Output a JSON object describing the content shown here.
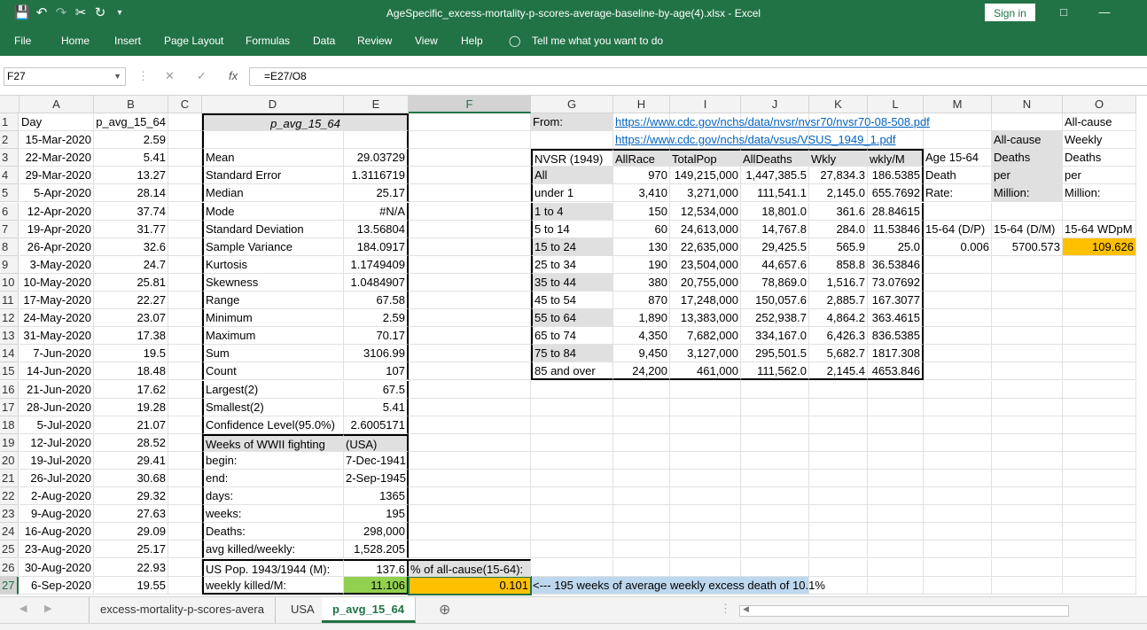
{
  "title": "AgeSpecific_excess-mortality-p-scores-average-baseline-by-age(4).xlsx  -  Excel",
  "sign_in": "Sign in",
  "ribbon_tabs": [
    "File",
    "Home",
    "Insert",
    "Page Layout",
    "Formulas",
    "Data",
    "Review",
    "View",
    "Help"
  ],
  "tell_me": "Tell me what you want to do",
  "name_box": "F27",
  "fx": "fx",
  "formula": "=E27/O8",
  "columns": [
    "A",
    "B",
    "C",
    "D",
    "E",
    "F",
    "G",
    "H",
    "I",
    "J",
    "K",
    "L",
    "M",
    "N",
    "O"
  ],
  "rows": [
    "1",
    "2",
    "3",
    "4",
    "5",
    "6",
    "7",
    "8",
    "9",
    "10",
    "11",
    "12",
    "13",
    "14",
    "15",
    "16",
    "17",
    "18",
    "19",
    "20",
    "21",
    "22",
    "23",
    "24",
    "25",
    "26",
    "27"
  ],
  "colA": [
    "Day",
    "15-Mar-2020",
    "22-Mar-2020",
    "29-Mar-2020",
    "5-Apr-2020",
    "12-Apr-2020",
    "19-Apr-2020",
    "26-Apr-2020",
    "3-May-2020",
    "10-May-2020",
    "17-May-2020",
    "24-May-2020",
    "31-May-2020",
    "7-Jun-2020",
    "14-Jun-2020",
    "21-Jun-2020",
    "28-Jun-2020",
    "5-Jul-2020",
    "12-Jul-2020",
    "19-Jul-2020",
    "26-Jul-2020",
    "2-Aug-2020",
    "9-Aug-2020",
    "16-Aug-2020",
    "23-Aug-2020",
    "30-Aug-2020",
    "6-Sep-2020"
  ],
  "colB": [
    "p_avg_15_64",
    "2.59",
    "5.41",
    "13.27",
    "28.14",
    "37.74",
    "31.77",
    "32.6",
    "24.7",
    "25.81",
    "22.27",
    "23.07",
    "17.38",
    "19.5",
    "18.48",
    "17.62",
    "19.28",
    "21.07",
    "28.52",
    "29.41",
    "30.68",
    "29.32",
    "27.63",
    "29.09",
    "25.17",
    "22.93",
    "19.55"
  ],
  "colD": [
    "p_avg_15_64",
    "",
    "Mean",
    "Standard Error",
    "Median",
    "Mode",
    "Standard Deviation",
    "Sample Variance",
    "Kurtosis",
    "Skewness",
    "Range",
    "Minimum",
    "Maximum",
    "Sum",
    "Count",
    "Largest(2)",
    "Smallest(2)",
    "Confidence Level(95.0%)",
    "Weeks of WWII fighting",
    "begin:",
    "end:",
    "days:",
    "weeks:",
    "Deaths:",
    "avg killed/weekly:",
    "US Pop. 1943/1944 (M):",
    "weekly killed/M:"
  ],
  "colE": [
    "",
    "",
    "29.03729",
    "1.3116719",
    "25.17",
    "#N/A",
    "13.56804",
    "184.0917",
    "1.1749409",
    "1.0484907",
    "67.58",
    "2.59",
    "70.17",
    "3106.99",
    "107",
    "67.5",
    "5.41",
    "2.6005171",
    "(USA)",
    "7-Dec-1941",
    "2-Sep-1945",
    "1365",
    "195",
    "298,000",
    "1,528.205",
    "137.6",
    "11.106"
  ],
  "F26": "% of all-cause(15-64):",
  "F27": "0.101",
  "G27": "<--- 195 weeks of average weekly excess death of 10.1%",
  "G1": "From:",
  "H1": "https://www.cdc.gov/nchs/data/nvsr/nvsr70/nvsr70-08-508.pdf",
  "H2": "https://www.cdc.gov/nchs/data/vsus/VSUS_1949_1.pdf",
  "nvsr_header": [
    "NVSR (1949)",
    "AllRace",
    "TotalPop",
    "AllDeaths",
    "Wkly",
    "wkly/M"
  ],
  "nvsr_rows": [
    [
      "All",
      "970",
      "149,215,000",
      "1,447,385.5",
      "27,834.3",
      "186.5385"
    ],
    [
      "under 1",
      "3,410",
      "3,271,000",
      "111,541.1",
      "2,145.0",
      "655.7692"
    ],
    [
      "1 to 4",
      "150",
      "12,534,000",
      "18,801.0",
      "361.6",
      "28.84615"
    ],
    [
      "5 to 14",
      "60",
      "24,613,000",
      "14,767.8",
      "284.0",
      "11.53846"
    ],
    [
      "15 to 24",
      "130",
      "22,635,000",
      "29,425.5",
      "565.9",
      "25.0"
    ],
    [
      "25 to 34",
      "190",
      "23,504,000",
      "44,657.6",
      "858.8",
      "36.53846"
    ],
    [
      "35 to 44",
      "380",
      "20,755,000",
      "78,869.0",
      "1,516.7",
      "73.07692"
    ],
    [
      "45 to 54",
      "870",
      "17,248,000",
      "150,057.6",
      "2,885.7",
      "167.3077"
    ],
    [
      "55 to 64",
      "1,890",
      "13,383,000",
      "252,938.7",
      "4,864.2",
      "363.4615"
    ],
    [
      "65 to 74",
      "4,350",
      "7,682,000",
      "334,167.0",
      "6,426.3",
      "836.5385"
    ],
    [
      "75 to 84",
      "9,450",
      "3,127,000",
      "295,501.5",
      "5,682.7",
      "1817.308"
    ],
    [
      "85 and over",
      "24,200",
      "461,000",
      "111,562.0",
      "2,145.4",
      "4653.846"
    ]
  ],
  "colM": [
    "",
    "",
    "Age 15-64",
    "Death",
    "Rate:",
    "",
    "15-64 (D/P)",
    "0.006"
  ],
  "colN": [
    "",
    "All-cause",
    "Deaths",
    "per",
    "Million:",
    "",
    "15-64 (D/M)",
    "5700.573"
  ],
  "colO": [
    "All-cause",
    "Weekly",
    "Deaths",
    "per",
    "Million:",
    "",
    "15-64 WDpM",
    "109.626"
  ],
  "sheet_tabs": [
    "excess-mortality-p-scores-avera",
    "USA",
    "p_avg_15_64"
  ],
  "active_sheet": "p_avg_15_64",
  "colors": {
    "excel_green": "#217346",
    "highlight_green": "#92d050",
    "highlight_orange": "#ffc000",
    "highlight_blue": "#bdd7ee",
    "link": "#0563c1"
  }
}
